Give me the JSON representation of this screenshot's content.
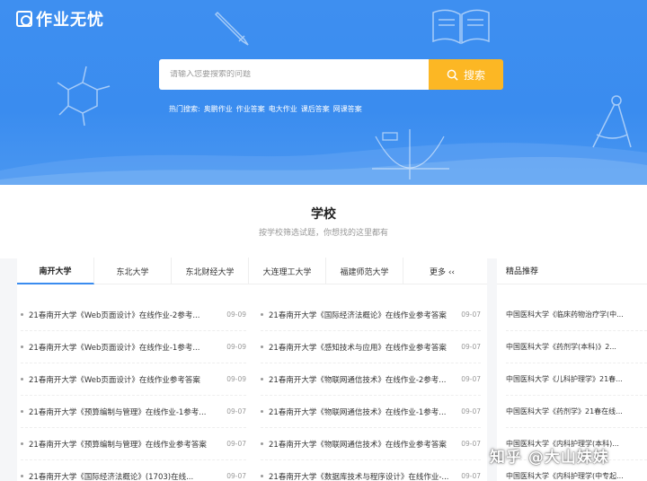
{
  "brand": {
    "name": "作业无忧"
  },
  "search": {
    "placeholder": "请输入您要搜索的问题",
    "button_label": "搜索"
  },
  "hot_searches": {
    "label": "热门搜索:",
    "items": [
      "奥鹏作业",
      "作业答案",
      "电大作业",
      "课后答案",
      "网课答案"
    ]
  },
  "section": {
    "title": "学校",
    "subtitle": "按学校筛选试题，你想找的这里都有"
  },
  "tabs": [
    "南开大学",
    "东北大学",
    "东北财经大学",
    "大连理工大学",
    "福建师范大学",
    "更多 ‹‹"
  ],
  "active_tab": 0,
  "list_left": [
    {
      "title": "21春南开大学《Web页面设计》在线作业-2参考...",
      "date": "09-09"
    },
    {
      "title": "21春南开大学《Web页面设计》在线作业-1参考...",
      "date": "09-09"
    },
    {
      "title": "21春南开大学《Web页面设计》在线作业参考答案",
      "date": "09-09"
    },
    {
      "title": "21春南开大学《预算编制与管理》在线作业-1参考...",
      "date": "09-07"
    },
    {
      "title": "21春南开大学《预算编制与管理》在线作业参考答案",
      "date": "09-07"
    },
    {
      "title": "21春南开大学《国际经济法概论》(1703)在线...",
      "date": "09-07"
    }
  ],
  "list_right": [
    {
      "title": "21春南开大学《国际经济法概论》在线作业参考答案",
      "date": "09-07"
    },
    {
      "title": "21春南开大学《感知技术与应用》在线作业参考答案",
      "date": "09-07"
    },
    {
      "title": "21春南开大学《物联网通信技术》在线作业-2参考...",
      "date": "09-07"
    },
    {
      "title": "21春南开大学《物联网通信技术》在线作业-1参考...",
      "date": "09-07"
    },
    {
      "title": "21春南开大学《物联网通信技术》在线作业参考答案",
      "date": "09-07"
    },
    {
      "title": "21春南开大学《数据库技术与程序设计》在线作业-...",
      "date": "09-07"
    }
  ],
  "featured": {
    "title": "精品推荐",
    "items": [
      "中国医科大学《临床药物治疗学(中...",
      "中国医科大学《药剂学(本科)》2...",
      "中国医科大学《儿科护理学》21春...",
      "中国医科大学《药剂学》21春在线...",
      "中国医科大学《内科护理学(本科)...",
      "中国医科大学《内科护理学(中专起..."
    ]
  },
  "watermark": "知乎 @大山妹妹",
  "colors": {
    "primary": "#3a8cef",
    "accent": "#fcb724"
  }
}
